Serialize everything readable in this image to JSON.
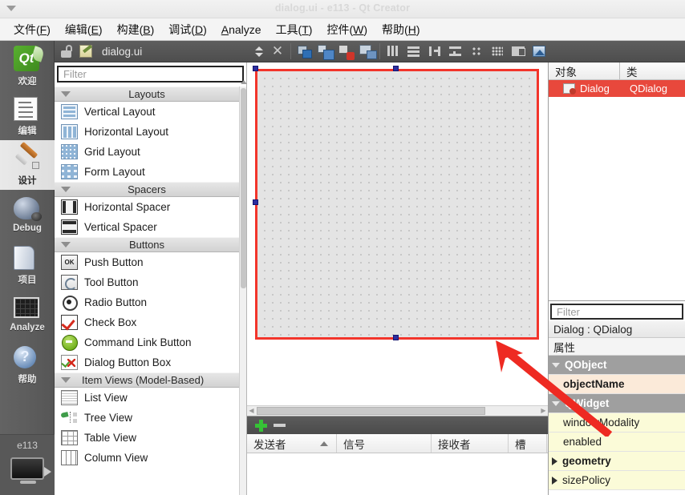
{
  "window": {
    "title": "dialog.ui - e113 - Qt Creator"
  },
  "menubar": {
    "items": [
      {
        "label": "文件(F)",
        "accel": "F"
      },
      {
        "label": "编辑(E)",
        "accel": "E"
      },
      {
        "label": "构建(B)",
        "accel": "B"
      },
      {
        "label": "调试(D)",
        "accel": "D"
      },
      {
        "label": "Analyze",
        "accel": "A"
      },
      {
        "label": "工具(T)",
        "accel": "T"
      },
      {
        "label": "控件(W)",
        "accel": "W"
      },
      {
        "label": "帮助(H)",
        "accel": "H"
      }
    ]
  },
  "modebar": {
    "items": [
      {
        "label": "欢迎",
        "icon": "qt-logo-icon",
        "active": false
      },
      {
        "label": "编辑",
        "icon": "edit-icon",
        "active": false
      },
      {
        "label": "设计",
        "icon": "design-brush-icon",
        "active": true
      },
      {
        "label": "Debug",
        "icon": "debug-bug-icon",
        "active": false
      },
      {
        "label": "项目",
        "icon": "projects-folder-icon",
        "active": false
      },
      {
        "label": "Analyze",
        "icon": "analyze-chart-icon",
        "active": false
      },
      {
        "label": "帮助",
        "icon": "help-question-icon",
        "active": false
      }
    ],
    "kit": {
      "label": "e113",
      "icon": "target-monitor-icon",
      "run_icon": "run-play-icon"
    }
  },
  "editor_toolbar": {
    "lock_icon": "unlocked-padlock-icon",
    "file_icon": "ui-file-icon",
    "filename": "dialog.ui",
    "dropdown_icon": "updown-arrows-icon",
    "close_icon": "close-x-icon",
    "buttons": [
      {
        "name": "edit-widgets-button",
        "icon": "edit-widgets-icon"
      },
      {
        "name": "edit-signals-slots-button",
        "icon": "edit-signals-slots-icon"
      },
      {
        "name": "edit-buddies-button",
        "icon": "edit-buddies-icon"
      },
      {
        "name": "edit-tab-order-button",
        "icon": "edit-tab-order-icon"
      },
      {
        "name": "layout-horizontally-button",
        "icon": "layout-horizontal-icon"
      },
      {
        "name": "layout-vertically-button",
        "icon": "layout-vertical-icon"
      },
      {
        "name": "layout-splitter-horizontal-button",
        "icon": "splitter-horizontal-icon"
      },
      {
        "name": "layout-splitter-vertical-button",
        "icon": "splitter-vertical-icon"
      },
      {
        "name": "layout-form-button",
        "icon": "layout-form-icon"
      },
      {
        "name": "layout-grid-button",
        "icon": "layout-grid-icon"
      },
      {
        "name": "break-layout-button",
        "icon": "break-layout-icon"
      },
      {
        "name": "preview-button",
        "icon": "preview-icon"
      }
    ]
  },
  "widget_box": {
    "filter_placeholder": "Filter",
    "groups": [
      {
        "title": "Layouts",
        "align": "center",
        "items": [
          {
            "label": "Vertical Layout",
            "icon": "vertical-layout-icon"
          },
          {
            "label": "Horizontal Layout",
            "icon": "horizontal-layout-icon"
          },
          {
            "label": "Grid Layout",
            "icon": "grid-layout-icon"
          },
          {
            "label": "Form Layout",
            "icon": "form-layout-icon"
          }
        ]
      },
      {
        "title": "Spacers",
        "align": "center",
        "items": [
          {
            "label": "Horizontal Spacer",
            "icon": "horizontal-spacer-icon"
          },
          {
            "label": "Vertical Spacer",
            "icon": "vertical-spacer-icon"
          }
        ]
      },
      {
        "title": "Buttons",
        "align": "center",
        "items": [
          {
            "label": "Push Button",
            "icon": "push-button-icon"
          },
          {
            "label": "Tool Button",
            "icon": "tool-button-icon"
          },
          {
            "label": "Radio Button",
            "icon": "radio-button-icon"
          },
          {
            "label": "Check Box",
            "icon": "check-box-icon"
          },
          {
            "label": "Command Link Button",
            "icon": "command-link-icon"
          },
          {
            "label": "Dialog Button Box",
            "icon": "dialog-button-box-icon"
          }
        ]
      },
      {
        "title": "Item Views (Model-Based)",
        "align": "left",
        "items": [
          {
            "label": "List View",
            "icon": "list-view-icon"
          },
          {
            "label": "Tree View",
            "icon": "tree-view-icon"
          },
          {
            "label": "Table View",
            "icon": "table-view-icon"
          },
          {
            "label": "Column View",
            "icon": "column-view-icon"
          }
        ]
      }
    ]
  },
  "canvas": {
    "form_name": "Dialog",
    "selection_color": "#2d2d9e",
    "highlight_color": "#f2352b"
  },
  "signal_slot_editor": {
    "add_icon": "plus-icon",
    "remove_icon": "minus-icon",
    "columns": [
      "发送者",
      "信号",
      "接收者",
      "槽"
    ],
    "rows": []
  },
  "object_inspector": {
    "columns": [
      "对象",
      "类"
    ],
    "rows": [
      {
        "object": "Dialog",
        "class": "QDialog",
        "selected": true,
        "icon": "qdialog-icon"
      }
    ],
    "selected_row_color": "#e8483c"
  },
  "property_editor": {
    "filter_placeholder": "Filter",
    "target": "Dialog : QDialog",
    "column_header": "属性",
    "rows": [
      {
        "label": "QObject",
        "kind": "group"
      },
      {
        "label": "objectName",
        "kind": "peach"
      },
      {
        "label": "QWidget",
        "kind": "group"
      },
      {
        "label": "windowModality",
        "kind": "cream"
      },
      {
        "label": "enabled",
        "kind": "cream"
      },
      {
        "label": "geometry",
        "kind": "cream-expand-bold"
      },
      {
        "label": "sizePolicy",
        "kind": "cream-expand"
      }
    ]
  },
  "annotation": {
    "arrow_color": "#ee2a22",
    "arrow_from": "property-editor",
    "arrow_to": "dialog-form-bottom-edge"
  }
}
